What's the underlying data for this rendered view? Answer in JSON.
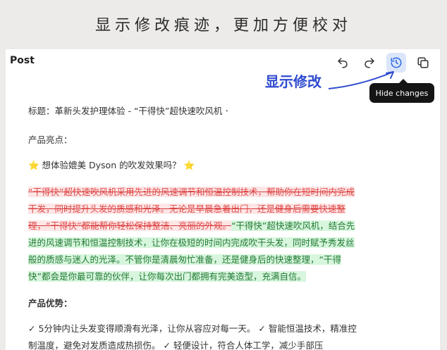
{
  "banner": {
    "text": "显示修改痕迹，更加方便校对"
  },
  "window": {
    "title": "Post"
  },
  "toolbar": {
    "undo_icon": "undo-icon",
    "redo_icon": "redo-icon",
    "history_icon": "history-icon",
    "copy_icon": "copy-icon",
    "tooltip": "Hide changes"
  },
  "annotation": {
    "text": "显示修改"
  },
  "content": {
    "heading": "标题：革新头发护理体验 - “干得快”超快速吹风机",
    "section1": "产品亮点：",
    "highlight_pre": "⭐",
    "highlight_text": " 想体验媲美 Dyson 的吹发效果吗？ ",
    "highlight_post": "⭐",
    "deleted": "“干得快”超快速吹风机采用先进的风速调节和恒温控制技术，帮助你在短时间内完成干发，同时提升头发的质感和光泽。无论是早晨急着出门，还是健身后需要快速整理，“干得快”都能帮你轻松保持整洁、亮丽的外观。",
    "inserted": "“干得快”超快速吹风机，结合先进的风速调节和恒温控制技术，让你在极短的时间内完成吹干头发，同时赋予秀发丝般的质感与迷人的光泽。不管你是清晨匆忙准备，还是健身后的快速整理，“干得快”都会是你最可靠的伙伴，让你每次出门都拥有完美造型，充满自信。",
    "section2": "产品优势：",
    "advantages": "✓ 5分钟内让头发变得顺滑有光泽，让你从容应对每一天。 ✓ 智能恒温技术，精准控制温度，避免对发质造成热损伤。 ✓ 轻便设计，符合人体工学，减少手部压"
  },
  "colors": {
    "accent": "#2f67e0",
    "deleted": "#e04848",
    "inserted": "#237a34",
    "annotation": "#2f4bd0"
  }
}
